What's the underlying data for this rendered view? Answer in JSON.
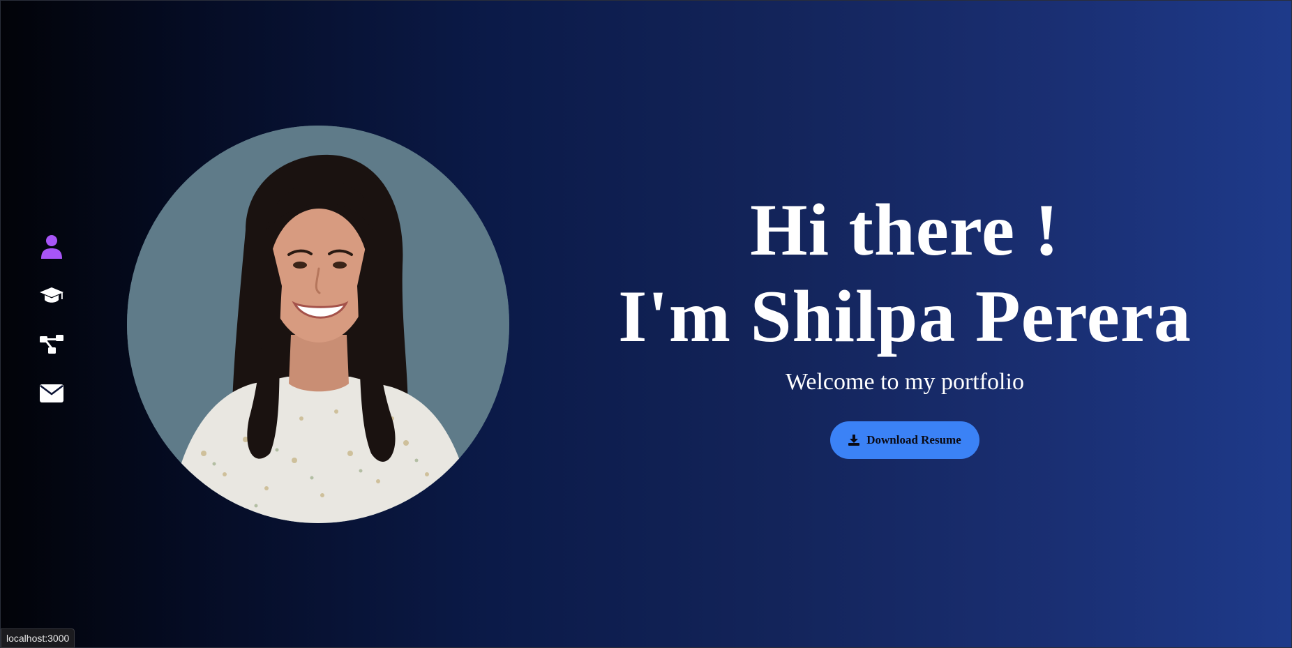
{
  "page": {
    "background_colors": [
      "#020308",
      "#1e3a8a"
    ]
  },
  "sidenav": {
    "items": [
      {
        "icon": "user-icon",
        "active": true,
        "color": "#a855f7"
      },
      {
        "icon": "graduation-cap-icon",
        "active": false,
        "color": "#ffffff"
      },
      {
        "icon": "project-diagram-icon",
        "active": false,
        "color": "#ffffff"
      },
      {
        "icon": "envelope-icon",
        "active": false,
        "color": "#ffffff"
      }
    ]
  },
  "profile": {
    "photo_background": "#5f7b89"
  },
  "hero": {
    "greeting": "Hi there !",
    "name_line": "I'm Shilpa Perera",
    "subtitle": "Welcome to my portfolio",
    "download_label": "Download Resume",
    "button_color": "#3b82f6"
  },
  "status_bar": {
    "url": "localhost:3000"
  }
}
